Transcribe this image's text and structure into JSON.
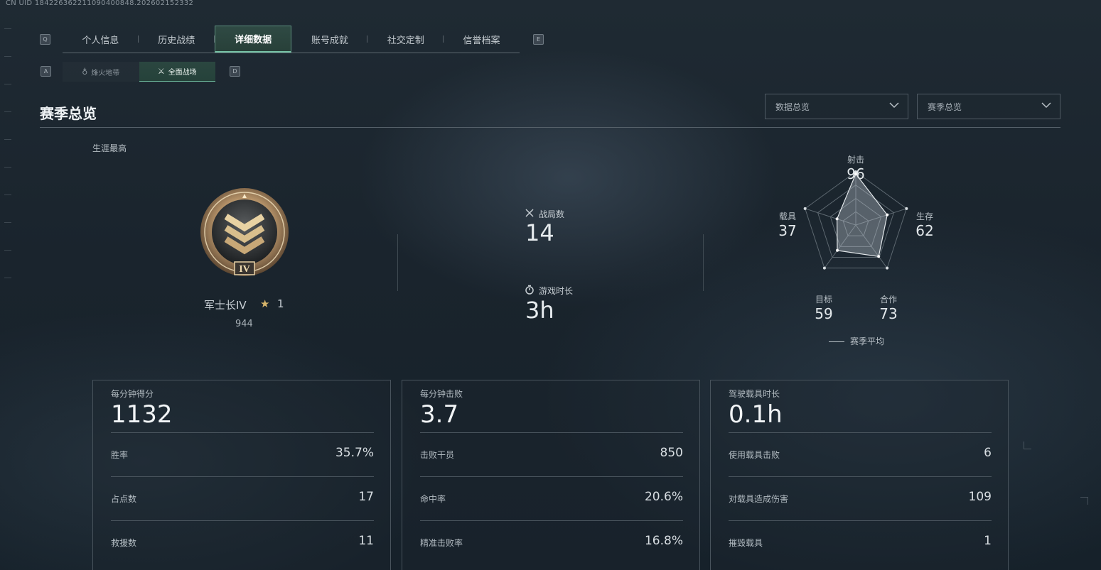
{
  "uid_text": "CN UID 18422636221109040084​8.20260215233​2",
  "tabs": {
    "left_key": "Q",
    "right_key": "E",
    "items": [
      {
        "label": "个人信息"
      },
      {
        "label": "历史战绩"
      },
      {
        "label": "详细数据",
        "active": true
      },
      {
        "label": "账号成就"
      },
      {
        "label": "社交定制"
      },
      {
        "label": "信誉档案"
      }
    ]
  },
  "subtabs": {
    "left_key": "A",
    "right_key": "D",
    "items": [
      {
        "label": "烽火地带",
        "icon": "flame-icon"
      },
      {
        "label": "全面战场",
        "icon": "battlefield-icon",
        "active": true
      }
    ]
  },
  "section": {
    "title": "赛季总览"
  },
  "dropdowns": [
    {
      "label": "数据总览"
    },
    {
      "label": "赛季总览"
    }
  ],
  "career": {
    "label": "生涯最高",
    "rank_name": "军士长IV",
    "rank_numeral": "IV",
    "stars": "1",
    "score": "944"
  },
  "summary": {
    "matches_label": "战局数",
    "matches_value": "14",
    "playtime_label": "游戏时长",
    "playtime_value": "3h"
  },
  "radar": {
    "axes": [
      {
        "label": "射击",
        "value": "96"
      },
      {
        "label": "生存",
        "value": "62"
      },
      {
        "label": "合作",
        "value": "73"
      },
      {
        "label": "目标",
        "value": "59"
      },
      {
        "label": "载具",
        "value": "37"
      }
    ],
    "values": [
      96,
      62,
      73,
      59,
      37
    ],
    "legend": "赛季平均"
  },
  "cards": [
    {
      "title": "每分钟得分",
      "value": "1132",
      "rows": [
        {
          "label": "胜率",
          "value": "35.7%"
        },
        {
          "label": "占点数",
          "value": "17"
        },
        {
          "label": "救援数",
          "value": "11"
        }
      ]
    },
    {
      "title": "每分钟击败",
      "value": "3.7",
      "rows": [
        {
          "label": "击败干员",
          "value": "850"
        },
        {
          "label": "命中率",
          "value": "20.6%"
        },
        {
          "label": "精准击败率",
          "value": "16.8%"
        }
      ]
    },
    {
      "title": "驾驶载具时长",
      "value": "0.1h",
      "rows": [
        {
          "label": "使用载具击败",
          "value": "6"
        },
        {
          "label": "对载具造成伤害",
          "value": "109"
        },
        {
          "label": "摧毁载具",
          "value": "1"
        }
      ]
    }
  ]
}
